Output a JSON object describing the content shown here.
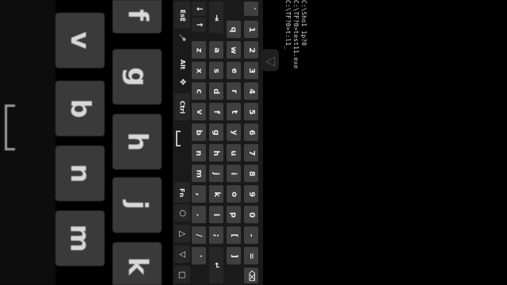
{
  "background_keys": {
    "f": "f",
    "v": "v",
    "g": "g",
    "b": "b",
    "h": "h",
    "n": "n",
    "j": "j",
    "m": "m",
    "k": "k"
  },
  "terminal_lines": [
    "C:\\Sho1 1p?0",
    "C:\\TF?0>test11.exe",
    "C:\\TF?0>t:l1_"
  ],
  "keyboard": {
    "col1": [
      "Esc",
      "Ctrl",
      "Alt",
      "Fn"
    ],
    "col1_icons": {
      "shift": "⇧",
      "mic": "🎤",
      "settings": "✥",
      "left": "◁",
      "home": "○",
      "recent": "□",
      "up": "△",
      "back": "▽"
    },
    "col2": [
      "↓",
      "↑",
      "z",
      "x",
      "c",
      "v",
      "b",
      "n",
      "m",
      ",",
      ".",
      "/",
      "'"
    ],
    "col3": [
      "⇥",
      "a",
      "s",
      "d",
      "f",
      "g",
      "h",
      "j",
      "k",
      "l",
      ";",
      "↵"
    ],
    "col4": [
      "q",
      "w",
      "e",
      "r",
      "t",
      "y",
      "u",
      "i",
      "o",
      "p",
      "[",
      "]"
    ],
    "col5": [
      "`",
      "1",
      "2",
      "3",
      "4",
      "5",
      "6",
      "7",
      "8",
      "9",
      "0",
      "-",
      "="
    ],
    "col5_extra": "⌫"
  }
}
